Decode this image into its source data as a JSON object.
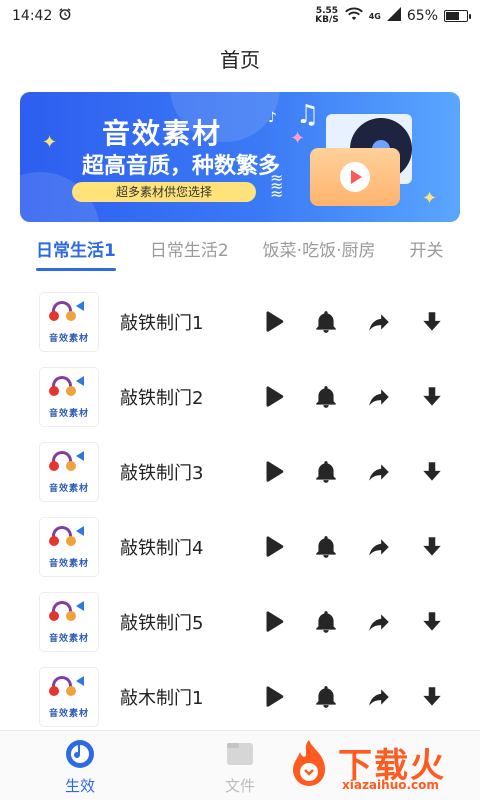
{
  "status_bar": {
    "time": "14:42",
    "speed_value": "5.55",
    "speed_unit": "KB/S",
    "network": "4G",
    "battery": "65%",
    "battery_level": 0.65
  },
  "header": {
    "title": "首页"
  },
  "banner": {
    "title": "音效素材",
    "subtitle": "超高音质，种数繁多",
    "tag": "超多素材供您选择"
  },
  "tabs": [
    {
      "label": "日常生活1",
      "active": true
    },
    {
      "label": "日常生活2",
      "active": false
    },
    {
      "label": "饭菜·吃饭·厨房",
      "active": false
    },
    {
      "label": "开关",
      "active": false
    }
  ],
  "list": {
    "thumb_text": "音效素材",
    "items": [
      {
        "title": "敲铁制门1"
      },
      {
        "title": "敲铁制门2"
      },
      {
        "title": "敲铁制门3"
      },
      {
        "title": "敲铁制门4"
      },
      {
        "title": "敲铁制门5"
      },
      {
        "title": "敲木制门1"
      }
    ]
  },
  "bottom_nav": {
    "effects_label": "生效",
    "files_label": "文件"
  },
  "watermark": {
    "brand": "下载火",
    "url": "xiazaihuo.com"
  },
  "colors": {
    "accent": "#2e6ae6",
    "banner_start": "#2d5ef0",
    "banner_end": "#5aa6ff",
    "watermark": "#ff5a1f"
  }
}
